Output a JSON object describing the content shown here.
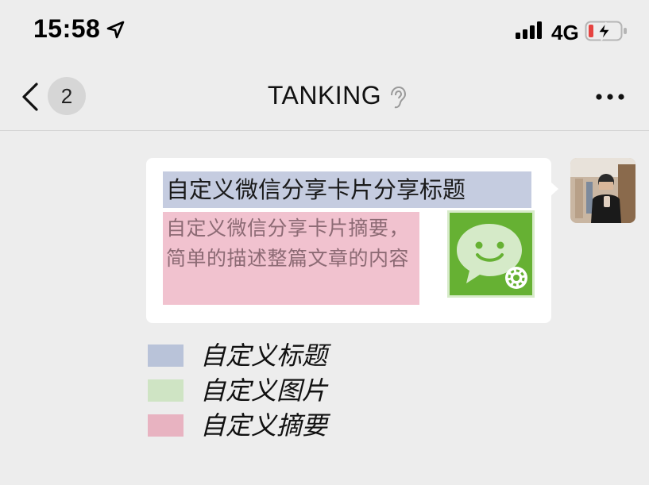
{
  "status_bar": {
    "time": "15:58",
    "network": "4G",
    "icons": [
      "location-arrow-icon",
      "cellular-signal-icon",
      "battery-charging-icon"
    ],
    "battery_color": "#e64340"
  },
  "nav": {
    "unread_count": "2",
    "title": "TANKING",
    "icons": [
      "chevron-left-icon",
      "ear-icon",
      "more-dots-icon"
    ]
  },
  "share_card": {
    "title": "自定义微信分享卡片分享标题",
    "description": "自定义微信分享卡片摘要，简单的描述整篇文章的内容",
    "thumbnail_icon": "wechat-logo-icon",
    "title_highlight_color": "#c5cce0",
    "description_highlight_color": "#f1c2cf",
    "thumbnail_highlight_color": "#d7ebc9"
  },
  "legend": {
    "items": [
      {
        "label": "自定义标题",
        "color": "#b9c3d9"
      },
      {
        "label": "自定义图片",
        "color": "#cfe4c4"
      },
      {
        "label": "自定义摘要",
        "color": "#e8b3c1"
      }
    ]
  },
  "colors": {
    "background": "#ededed",
    "bubble": "#ffffff",
    "wechat_green": "#66b133"
  }
}
